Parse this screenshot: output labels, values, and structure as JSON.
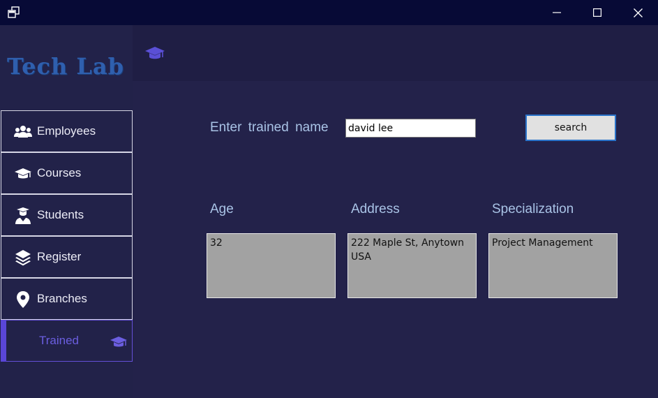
{
  "app": {
    "title": "Tech Lab"
  },
  "window_controls": {
    "app_icon": "restore-windows-icon",
    "minimize": "minimize-icon",
    "maximize": "maximize-icon",
    "close": "close-icon"
  },
  "sidebar": {
    "items": [
      {
        "label": "Employees",
        "icon": "users-icon"
      },
      {
        "label": "Courses",
        "icon": "graduation-cap-icon"
      },
      {
        "label": "Students",
        "icon": "student-icon"
      },
      {
        "label": "Register",
        "icon": "layers-icon"
      },
      {
        "label": "Branches",
        "icon": "map-pin-icon"
      },
      {
        "label": "Trained",
        "icon": "graduation-cap-icon",
        "active": true
      }
    ]
  },
  "header": {
    "icon": "graduation-cap-icon"
  },
  "search": {
    "prompt": "Enter trained name",
    "value": "david lee",
    "button_label": "search"
  },
  "details": {
    "age_label": "Age",
    "age_value": "32",
    "address_label": "Address",
    "address_value": "222 Maple St, Anytown USA",
    "specialization_label": "Specialization",
    "specialization_value": "Project Management"
  },
  "colors": {
    "titlebar": "#070a36",
    "background": "#23224a",
    "logo": "#2f5fae",
    "active_accent": "#5a46d8",
    "label_text": "#a9c3e6"
  }
}
